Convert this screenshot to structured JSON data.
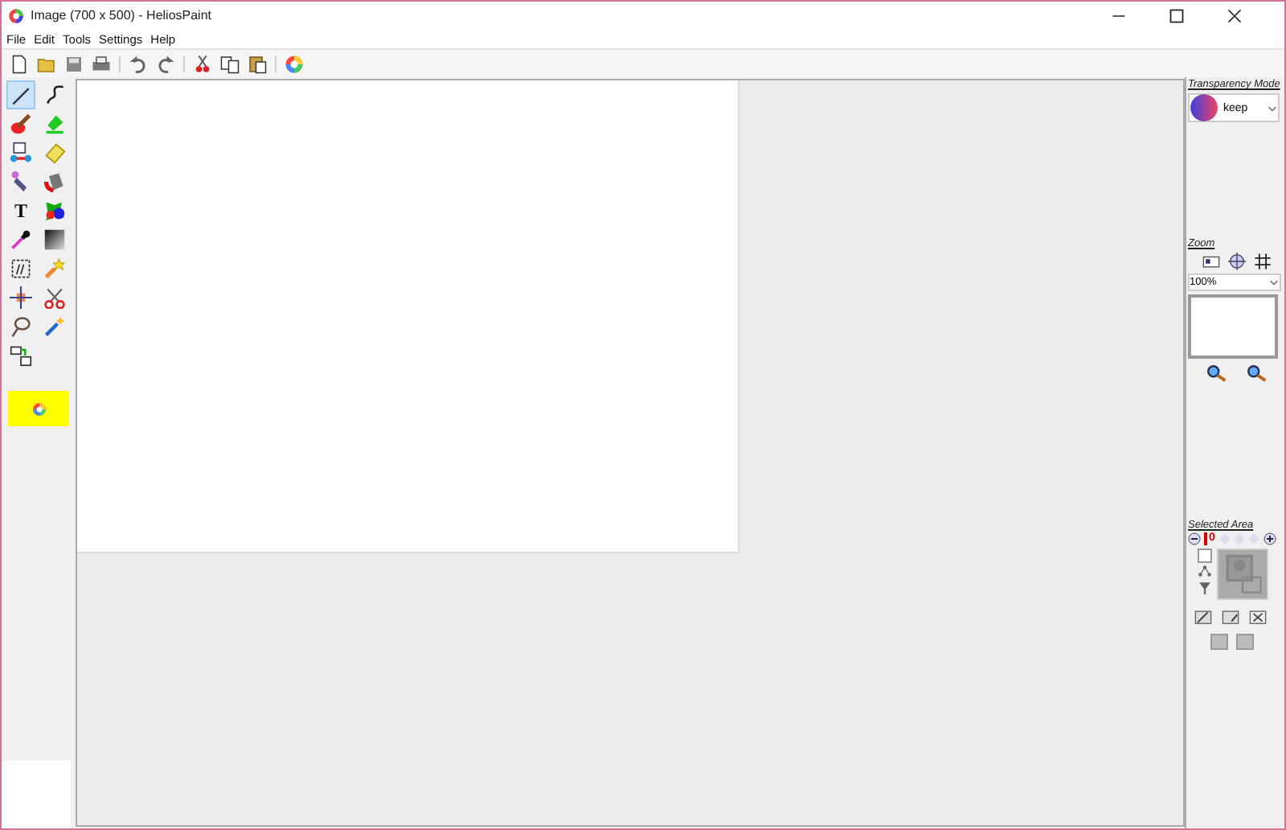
{
  "window": {
    "title": "Image (700 x 500)  - HeliosPaint"
  },
  "menu": [
    "File",
    "Edit",
    "Tools",
    "Settings",
    "Help"
  ],
  "tools": [
    {
      "selected": true
    },
    {
      "selected": false
    },
    {
      "selected": false
    },
    {
      "selected": false
    },
    {
      "selected": false
    },
    {
      "selected": false
    },
    {
      "selected": false
    },
    {
      "selected": false
    },
    {
      "selected": false,
      "glyph": "T"
    },
    {
      "selected": false
    },
    {
      "selected": false
    },
    {
      "selected": false
    },
    {
      "selected": false
    },
    {
      "selected": false
    },
    {
      "selected": false
    },
    {
      "selected": false
    },
    {
      "selected": false
    },
    {
      "selected": false
    },
    {
      "selected": false
    }
  ],
  "transparency": {
    "label": "Transparency Mode",
    "value": "keep"
  },
  "zoom": {
    "label": "Zoom",
    "value": "100%"
  },
  "selected_area": {
    "label": "Selected Area",
    "value": "0",
    "checked": false
  }
}
